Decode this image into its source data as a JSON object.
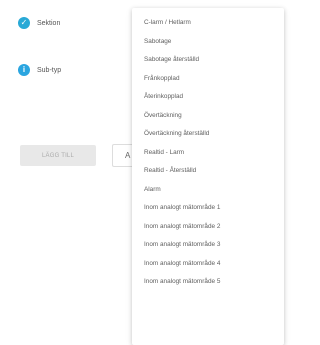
{
  "fields": [
    {
      "label": "Sektion",
      "status": "ok",
      "icon": "check-circle-icon"
    },
    {
      "label": "Sub-typ",
      "status": "info",
      "icon": "info-circle-icon"
    }
  ],
  "buttons": {
    "disabled_label": "LÄGG TILL",
    "partial_label": "A"
  },
  "dropdown": {
    "options": [
      "C-larm / Hetlarm",
      "Sabotage",
      "Sabotage återställd",
      "Frånkopplad",
      "Återinkopplad",
      "Övertäckning",
      "Övertäckning återställd",
      "Realtid - Larm",
      "Realtid - Återställd",
      "Alarm",
      "Inom analogt mätområde 1",
      "Inom analogt mätområde 2",
      "Inom analogt mätområde 3",
      "Inom analogt mätområde 4",
      "Inom analogt mätområde 5"
    ]
  },
  "colors": {
    "ok": "#29a9d6",
    "info": "#2aa5e0"
  }
}
